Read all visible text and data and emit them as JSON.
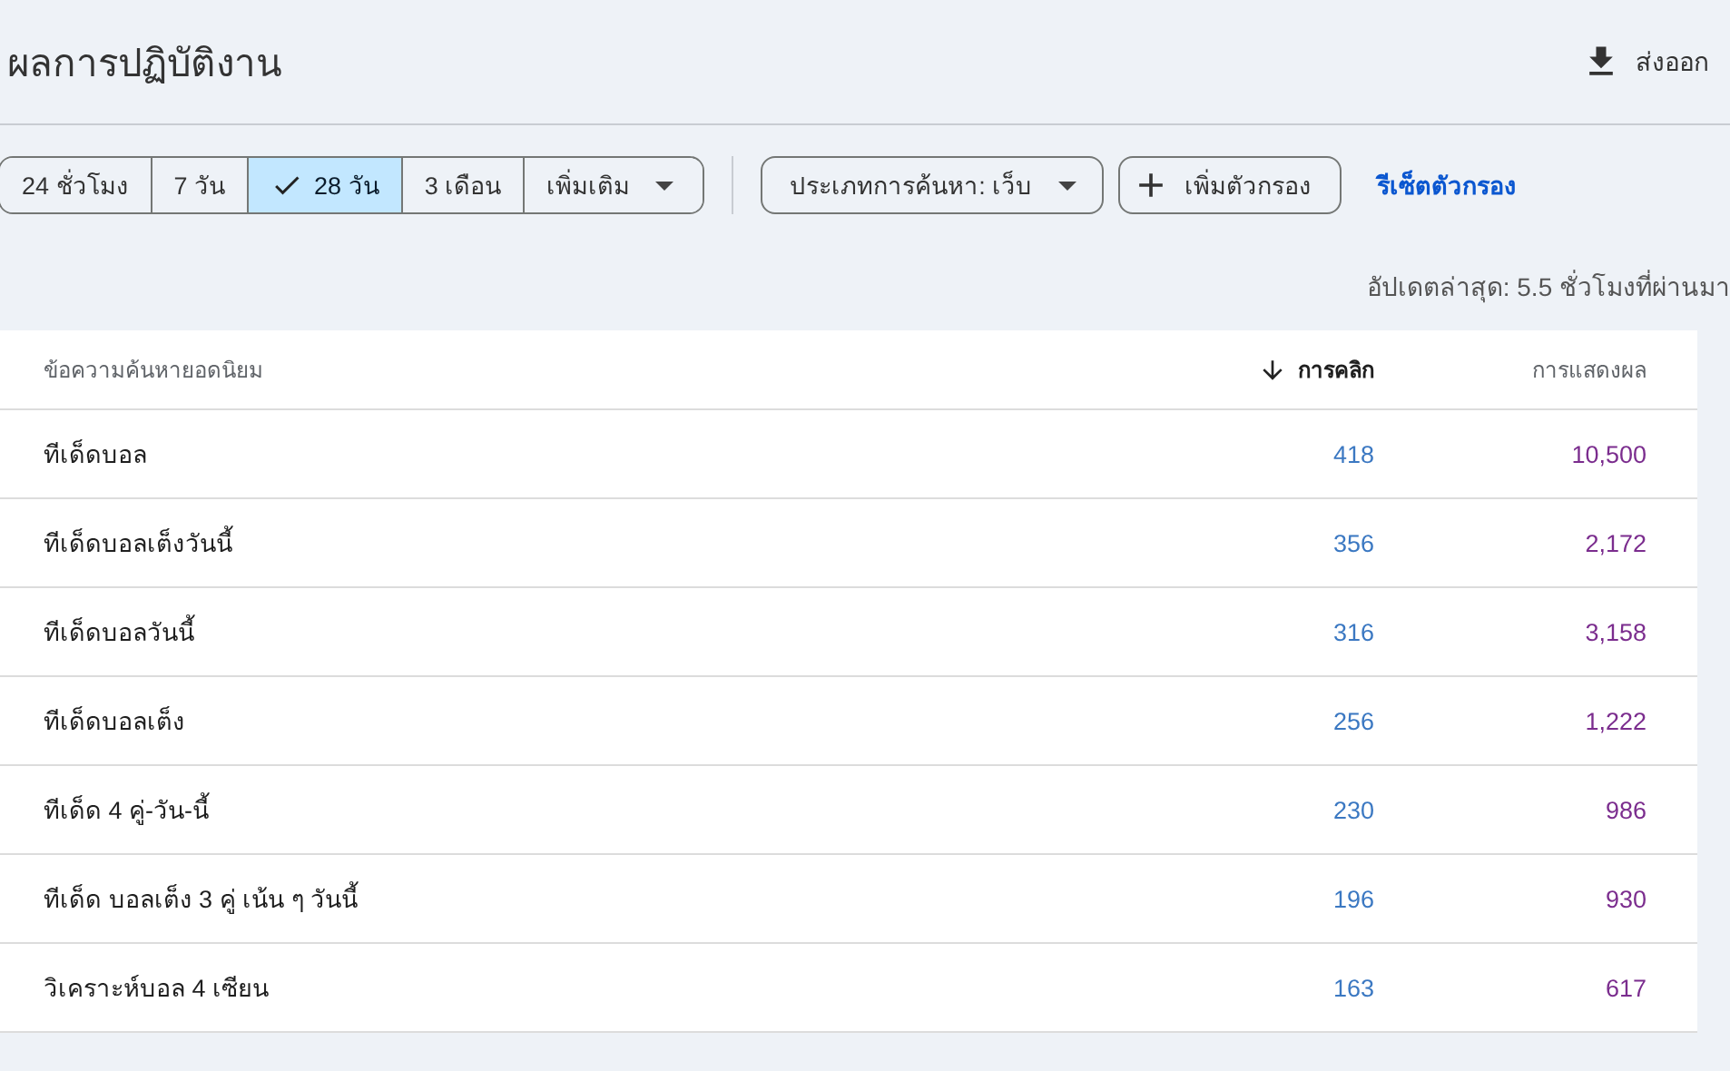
{
  "header": {
    "title": "ผลการปฏิบัติงาน",
    "export_label": "ส่งออก"
  },
  "time_ranges": [
    {
      "label": "24 ชั่วโมง",
      "selected": false
    },
    {
      "label": "7 วัน",
      "selected": false
    },
    {
      "label": "28 วัน",
      "selected": true
    },
    {
      "label": "3 เดือน",
      "selected": false
    }
  ],
  "more_dropdown": "เพิ่มเติม",
  "search_type_dropdown": "ประเภทการค้นหา: เว็บ",
  "add_filter_button": "เพิ่มตัวกรอง",
  "reset_filters_link": "รีเซ็ตตัวกรอง",
  "last_updated": "อัปเดตล่าสุด: 5.5 ชั่วโมงที่ผ่านมา",
  "table": {
    "columns": [
      {
        "label": "ข้อความค้นหายอดนิยม",
        "sorted": false
      },
      {
        "label": "การคลิก",
        "sorted": true
      },
      {
        "label": "การแสดงผล",
        "sorted": false
      }
    ],
    "rows": [
      {
        "query": "ทีเด็ดบอล",
        "clicks": "418",
        "impressions": "10,500"
      },
      {
        "query": "ทีเด็ดบอลเต็งวันนี้",
        "clicks": "356",
        "impressions": "2,172"
      },
      {
        "query": "ทีเด็ดบอลวันนี้",
        "clicks": "316",
        "impressions": "3,158"
      },
      {
        "query": "ทีเด็ดบอลเต็ง",
        "clicks": "256",
        "impressions": "1,222"
      },
      {
        "query": "ทีเด็ด 4 คู่-วัน-นี้",
        "clicks": "230",
        "impressions": "986"
      },
      {
        "query": "ทีเด็ด บอลเต็ง 3 คู่ เน้น ๆ วันนี้",
        "clicks": "196",
        "impressions": "930"
      },
      {
        "query": "วิเคราะห์บอล 4 เซียน",
        "clicks": "163",
        "impressions": "617"
      }
    ]
  }
}
